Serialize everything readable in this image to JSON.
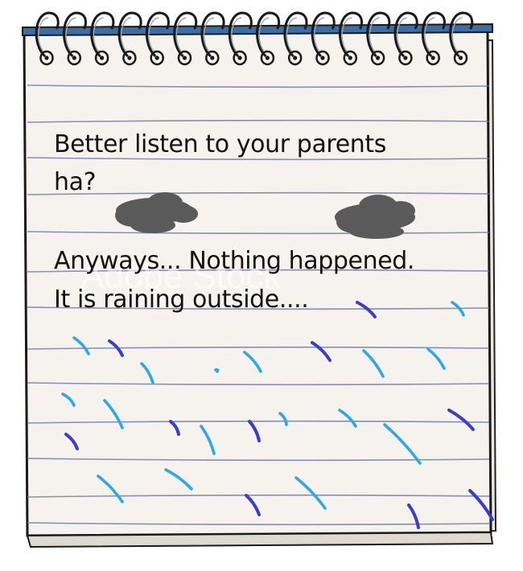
{
  "note": {
    "lines": [
      "Better listen to your parents",
      "ha?",
      "Anyways... Nothing happened.",
      "It is raining outside...."
    ]
  },
  "watermark": {
    "text": "Adobe Stock"
  },
  "colors": {
    "paper": "#f6f3ee",
    "ruled_line": "#5a6fa0",
    "spiral_bar": "#3b6ea5",
    "rain_light": "#2ea8e6",
    "rain_dark": "#3a3ec8",
    "cloud": "#5a5a5a"
  }
}
